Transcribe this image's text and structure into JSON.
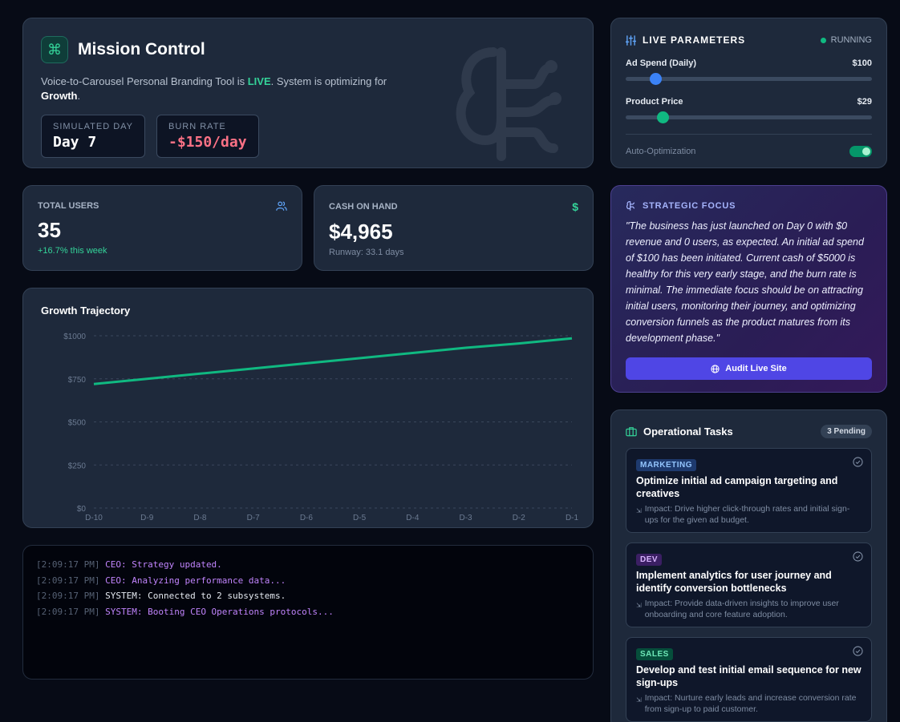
{
  "mission": {
    "logo_glyph": "⌘",
    "title": "Mission Control",
    "subtitle_prefix": "Voice-to-Carousel Personal Branding Tool is ",
    "subtitle_live": "LIVE",
    "subtitle_mid": ". System is optimizing for ",
    "subtitle_goal": "Growth",
    "subtitle_end": ".",
    "sim_day_label": "SIMULATED DAY",
    "sim_day_value": "Day 7",
    "burn_label": "BURN RATE",
    "burn_value": "-$150/day"
  },
  "params": {
    "title": "LIVE PARAMETERS",
    "status": "RUNNING",
    "ad_spend_label": "Ad Spend (Daily)",
    "ad_spend_value": "$100",
    "ad_spend_level": 0.12,
    "price_label": "Product Price",
    "price_value": "$29",
    "price_level": 0.15,
    "auto_label": "Auto-Optimization",
    "auto_on": true,
    "accent_blue": "#3b82f6",
    "accent_green": "#10b981"
  },
  "users": {
    "label": "TOTAL USERS",
    "value": "35",
    "note": "+16.7% this week",
    "icon": "users-icon"
  },
  "cash": {
    "label": "CASH ON HAND",
    "value": "$4,965",
    "note": "Runway: 33.1 days",
    "icon": "dollar-icon"
  },
  "chart_data": {
    "type": "line",
    "title": "Growth Trajectory",
    "categories": [
      "D-10",
      "D-9",
      "D-8",
      "D-7",
      "D-6",
      "D-5",
      "D-4",
      "D-3",
      "D-2",
      "D-1"
    ],
    "series": [
      {
        "values": [
          720,
          750,
          780,
          810,
          840,
          870,
          900,
          930,
          955,
          985
        ],
        "color": "#10b981"
      }
    ],
    "yticks": [
      "$0",
      "$250",
      "$500",
      "$750",
      "$1000"
    ],
    "ylim": [
      0,
      1000
    ],
    "grid": true
  },
  "strategy": {
    "title": "STRATEGIC FOCUS",
    "quote": "\"The business has just launched on Day 0 with $0 revenue and 0 users, as expected. An initial ad spend of $100 has been initiated. Current cash of $5000 is healthy for this very early stage, and the burn rate is minimal. The immediate focus should be on attracting initial users, monitoring their journey, and optimizing conversion funnels as the product matures from its development phase.\"",
    "button": "Audit Live Site"
  },
  "terminal": {
    "lines": [
      {
        "ts": "[2:09:17 PM]",
        "msg": "CEO: Strategy updated."
      },
      {
        "ts": "[2:09:17 PM]",
        "msg": "CEO: Analyzing performance data..."
      },
      {
        "ts": "[2:09:17 PM]",
        "msg": "SYSTEM: Connected to 2 subsystems."
      },
      {
        "ts": "[2:09:17 PM]",
        "msg": "SYSTEM: Booting CEO Operations protocols..."
      }
    ]
  },
  "tasks": {
    "title": "Operational Tasks",
    "pending": "3 Pending",
    "items": [
      {
        "tag": "MARKETING",
        "title": "Optimize initial ad campaign targeting and creatives",
        "impact": "Impact: Drive higher click-through rates and initial sign-ups for the given ad budget."
      },
      {
        "tag": "DEV",
        "title": "Implement analytics for user journey and identify conversion bottlenecks",
        "impact": "Impact: Provide data-driven insights to improve user onboarding and core feature adoption."
      },
      {
        "tag": "SALES",
        "title": "Develop and test initial email sequence for new sign-ups",
        "impact": "Impact: Nurture early leads and increase conversion rate from sign-up to paid customer."
      }
    ]
  }
}
